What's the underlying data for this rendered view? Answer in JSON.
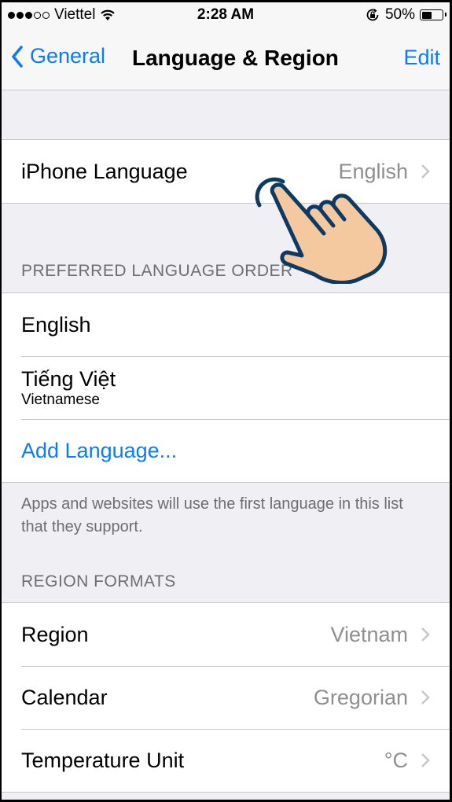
{
  "status_bar": {
    "signal_dots_filled": 3,
    "signal_dots_total": 5,
    "carrier": "Viettel",
    "wifi_icon": "wifi-icon",
    "time": "2:28 AM",
    "rotation_lock_icon": "rotation-lock-icon",
    "battery_percent_label": "50%",
    "battery_level": 0.5
  },
  "nav": {
    "back_label": "General",
    "title": "Language & Region",
    "edit_label": "Edit"
  },
  "language_section": {
    "rows": [
      {
        "label": "iPhone Language",
        "value": "English"
      }
    ]
  },
  "preferred_section": {
    "header": "PREFERRED LANGUAGE ORDER",
    "languages": [
      {
        "label": "English"
      },
      {
        "label": "Tiếng Việt",
        "sublabel": "Vietnamese"
      }
    ],
    "add_label": "Add Language...",
    "footer": "Apps and websites will use the first language in this list that they support."
  },
  "region_section": {
    "header": "REGION FORMATS",
    "rows": [
      {
        "label": "Region",
        "value": "Vietnam"
      },
      {
        "label": "Calendar",
        "value": "Gregorian"
      },
      {
        "label": "Temperature Unit",
        "value": "°C"
      }
    ]
  },
  "overlay": {
    "icon": "tap-hand-icon",
    "colors": {
      "outline": "#0d3a63",
      "fill": "#f5c9a0"
    }
  },
  "colors": {
    "accent": "#0a7aff",
    "secondary_text": "#8e8e93",
    "group_background": "#efeff4"
  }
}
